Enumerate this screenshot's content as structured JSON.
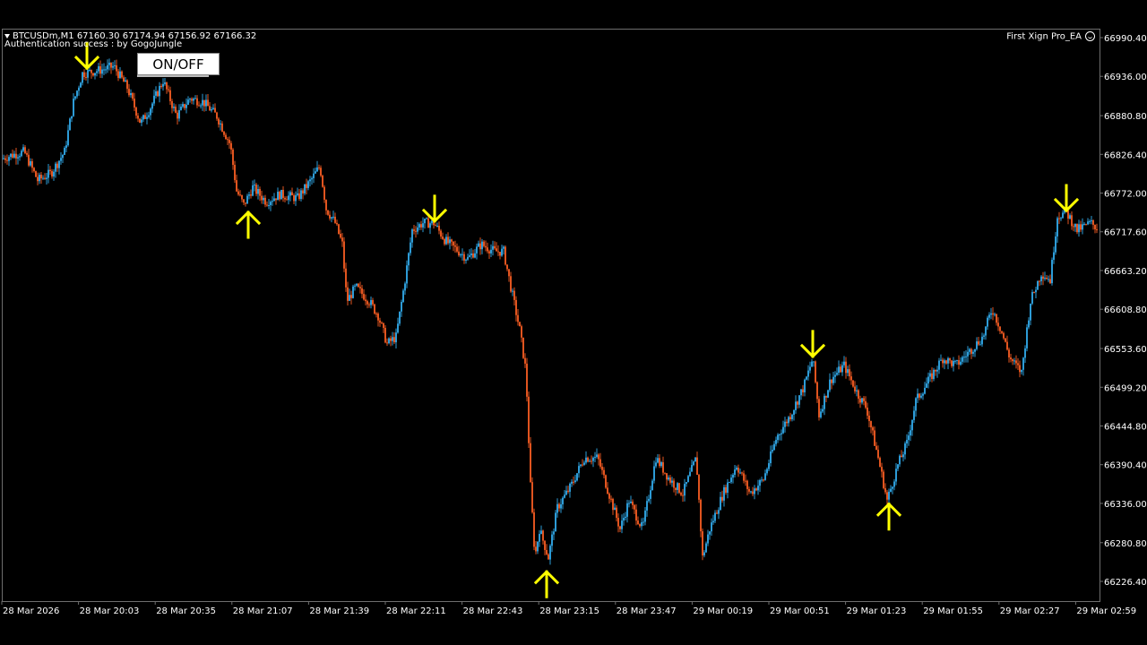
{
  "header": {
    "symbol_line": "BTCUSDm,M1  67160.30 67174.94 67156.92 67166.32",
    "auth_line": "Authentication success : by GogoJungle",
    "ea_name": "First Xign Pro_EA"
  },
  "controls": {
    "onoff_label": "ON/OFF"
  },
  "colors": {
    "bull": "#2d9bd6",
    "bear": "#e0541f",
    "arrow": "#ffff00",
    "axis_text": "#ffffff",
    "border": "#6e6e6e"
  },
  "chart_data": {
    "type": "candlestick",
    "symbol": "BTCUSDm",
    "timeframe": "M1",
    "ylim": [
      66200,
      67000
    ],
    "y_ticks": [
      "66990.40",
      "66936.00",
      "66880.80",
      "66826.40",
      "66772.00",
      "66717.60",
      "66663.20",
      "66608.80",
      "66553.60",
      "66499.20",
      "66444.80",
      "66390.40",
      "66336.00",
      "66280.80",
      "66226.40"
    ],
    "x_ticks": [
      "28 Mar 2026",
      "28 Mar 20:03",
      "28 Mar 20:35",
      "28 Mar 21:07",
      "28 Mar 21:39",
      "28 Mar 22:11",
      "28 Mar 22:43",
      "28 Mar 23:15",
      "28 Mar 23:47",
      "29 Mar 00:19",
      "29 Mar 00:51",
      "29 Mar 01:23",
      "29 Mar 01:55",
      "29 Mar 02:27",
      "29 Mar 02:59"
    ],
    "price_path": [
      [
        0,
        66820
      ],
      [
        10,
        66825
      ],
      [
        25,
        66830
      ],
      [
        40,
        66790
      ],
      [
        55,
        66800
      ],
      [
        70,
        66830
      ],
      [
        80,
        66900
      ],
      [
        90,
        66940
      ],
      [
        110,
        66945
      ],
      [
        125,
        66950
      ],
      [
        140,
        66920
      ],
      [
        155,
        66870
      ],
      [
        165,
        66890
      ],
      [
        180,
        66930
      ],
      [
        195,
        66880
      ],
      [
        210,
        66905
      ],
      [
        225,
        66900
      ],
      [
        240,
        66880
      ],
      [
        255,
        66840
      ],
      [
        262,
        66775
      ],
      [
        270,
        66755
      ],
      [
        280,
        66780
      ],
      [
        295,
        66760
      ],
      [
        310,
        66770
      ],
      [
        330,
        66765
      ],
      [
        345,
        66790
      ],
      [
        355,
        66810
      ],
      [
        362,
        66750
      ],
      [
        372,
        66730
      ],
      [
        380,
        66700
      ],
      [
        385,
        66620
      ],
      [
        395,
        66640
      ],
      [
        410,
        66620
      ],
      [
        420,
        66600
      ],
      [
        430,
        66560
      ],
      [
        440,
        66570
      ],
      [
        450,
        66650
      ],
      [
        458,
        66720
      ],
      [
        470,
        66730
      ],
      [
        482,
        66730
      ],
      [
        495,
        66705
      ],
      [
        510,
        66690
      ],
      [
        520,
        66680
      ],
      [
        535,
        66700
      ],
      [
        550,
        66690
      ],
      [
        560,
        66690
      ],
      [
        568,
        66640
      ],
      [
        578,
        66580
      ],
      [
        585,
        66520
      ],
      [
        590,
        66360
      ],
      [
        595,
        66260
      ],
      [
        600,
        66300
      ],
      [
        610,
        66260
      ],
      [
        620,
        66330
      ],
      [
        635,
        66360
      ],
      [
        650,
        66400
      ],
      [
        665,
        66400
      ],
      [
        680,
        66340
      ],
      [
        690,
        66300
      ],
      [
        700,
        66340
      ],
      [
        715,
        66300
      ],
      [
        730,
        66400
      ],
      [
        745,
        66370
      ],
      [
        760,
        66350
      ],
      [
        775,
        66400
      ],
      [
        782,
        66260
      ],
      [
        790,
        66300
      ],
      [
        805,
        66350
      ],
      [
        820,
        66390
      ],
      [
        835,
        66350
      ],
      [
        850,
        66370
      ],
      [
        865,
        66430
      ],
      [
        880,
        66460
      ],
      [
        895,
        66500
      ],
      [
        905,
        66540
      ],
      [
        912,
        66460
      ],
      [
        925,
        66510
      ],
      [
        940,
        66530
      ],
      [
        955,
        66490
      ],
      [
        965,
        66470
      ],
      [
        978,
        66400
      ],
      [
        988,
        66340
      ],
      [
        1000,
        66390
      ],
      [
        1010,
        66420
      ],
      [
        1020,
        66480
      ],
      [
        1035,
        66510
      ],
      [
        1050,
        66540
      ],
      [
        1065,
        66530
      ],
      [
        1080,
        66550
      ],
      [
        1095,
        66570
      ],
      [
        1105,
        66610
      ],
      [
        1115,
        66580
      ],
      [
        1125,
        66540
      ],
      [
        1138,
        66520
      ],
      [
        1148,
        66620
      ],
      [
        1160,
        66660
      ],
      [
        1170,
        66650
      ],
      [
        1178,
        66740
      ],
      [
        1188,
        66745
      ],
      [
        1200,
        66720
      ],
      [
        1215,
        66730
      ],
      [
        1226,
        66720
      ]
    ],
    "signals": [
      {
        "type": "sell",
        "x_index": 95,
        "price": 66950
      },
      {
        "type": "buy",
        "x_index": 275,
        "price": 66745
      },
      {
        "type": "sell",
        "x_index": 483,
        "price": 66735
      },
      {
        "type": "buy",
        "x_index": 608,
        "price": 66240
      },
      {
        "type": "sell",
        "x_index": 905,
        "price": 66545
      },
      {
        "type": "buy",
        "x_index": 990,
        "price": 66335
      },
      {
        "type": "sell",
        "x_index": 1188,
        "price": 66750
      }
    ]
  }
}
